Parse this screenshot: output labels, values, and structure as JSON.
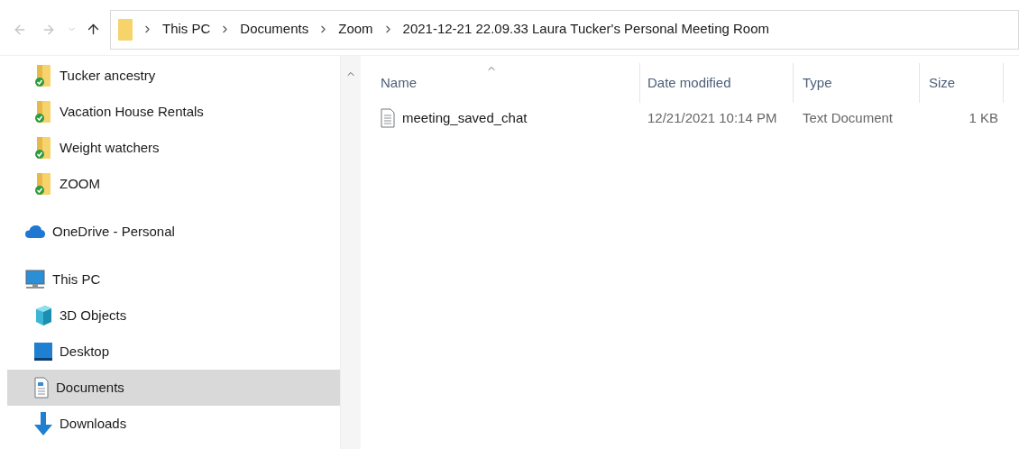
{
  "address_bar": {
    "breadcrumbs": [
      "This PC",
      "Documents",
      "Zoom",
      "2021-12-21 22.09.33 Laura Tucker's Personal Meeting Room"
    ]
  },
  "sidebar": {
    "quick_access_items": [
      {
        "label": "Tucker ancestry",
        "kind": "synced-folder",
        "selected": false
      },
      {
        "label": "Vacation House Rentals",
        "kind": "synced-folder",
        "selected": false
      },
      {
        "label": "Weight watchers",
        "kind": "synced-folder",
        "selected": false
      },
      {
        "label": "ZOOM",
        "kind": "synced-folder",
        "selected": false
      }
    ],
    "items": [
      {
        "label": "OneDrive - Personal",
        "kind": "cloud",
        "selected": false
      },
      {
        "label": "This PC",
        "kind": "computer",
        "selected": false,
        "children": [
          {
            "label": "3D Objects",
            "kind": "cube",
            "selected": false
          },
          {
            "label": "Desktop",
            "kind": "desktop",
            "selected": false
          },
          {
            "label": "Documents",
            "kind": "document",
            "selected": true
          },
          {
            "label": "Downloads",
            "kind": "download",
            "selected": false
          }
        ]
      }
    ]
  },
  "file_list": {
    "columns": [
      {
        "label": "Name",
        "sorted": true
      },
      {
        "label": "Date modified",
        "sorted": false
      },
      {
        "label": "Type",
        "sorted": false
      },
      {
        "label": "Size",
        "sorted": false
      }
    ],
    "rows": [
      {
        "name": "meeting_saved_chat",
        "date_modified": "12/21/2021 10:14 PM",
        "type": "Text Document",
        "size": "1 KB"
      }
    ]
  }
}
